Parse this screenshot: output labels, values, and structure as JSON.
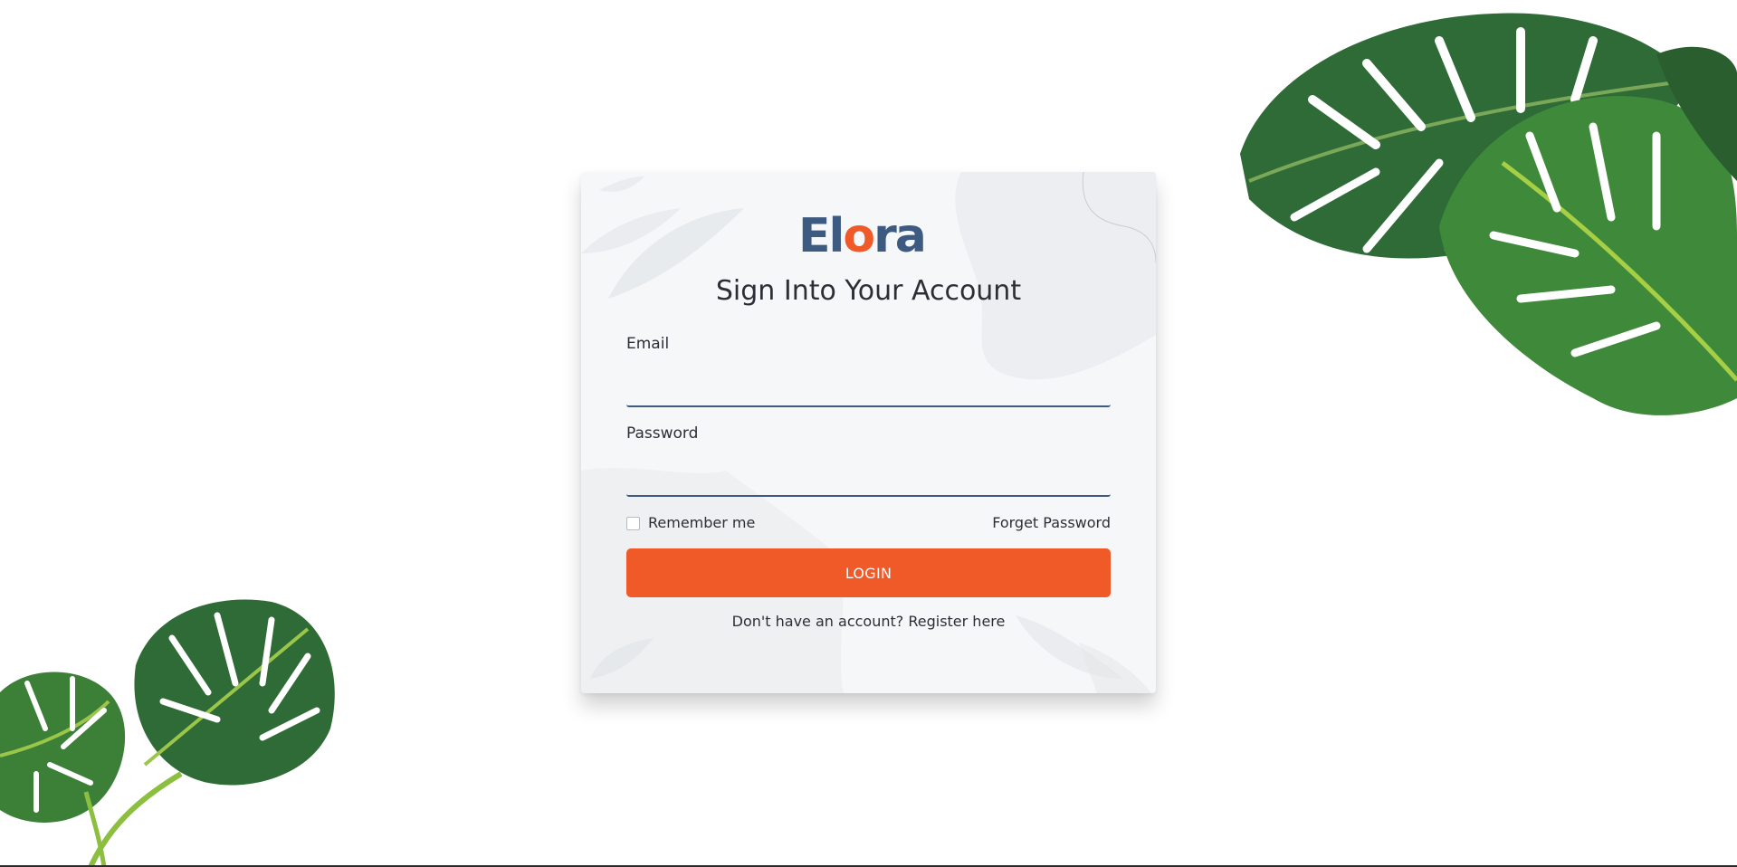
{
  "brand": {
    "logo_main_left": "El",
    "logo_accent": "o",
    "logo_main_right": "ra",
    "colors": {
      "primary": "#3d5a80",
      "accent": "#f05a28"
    }
  },
  "form": {
    "title": "Sign Into Your Account",
    "email_label": "Email",
    "email_value": "",
    "password_label": "Password",
    "password_value": "",
    "remember_label": "Remember me",
    "remember_checked": false,
    "forget_password_label": "Forget Password",
    "login_label": "LOGIN",
    "register_prompt": "Don't have an account?",
    "register_link": "Register here"
  },
  "decorations": {
    "top_right": "monstera-leaves",
    "bottom_left": "monstera-leaves",
    "card_background": "faded-fern-leaves"
  }
}
